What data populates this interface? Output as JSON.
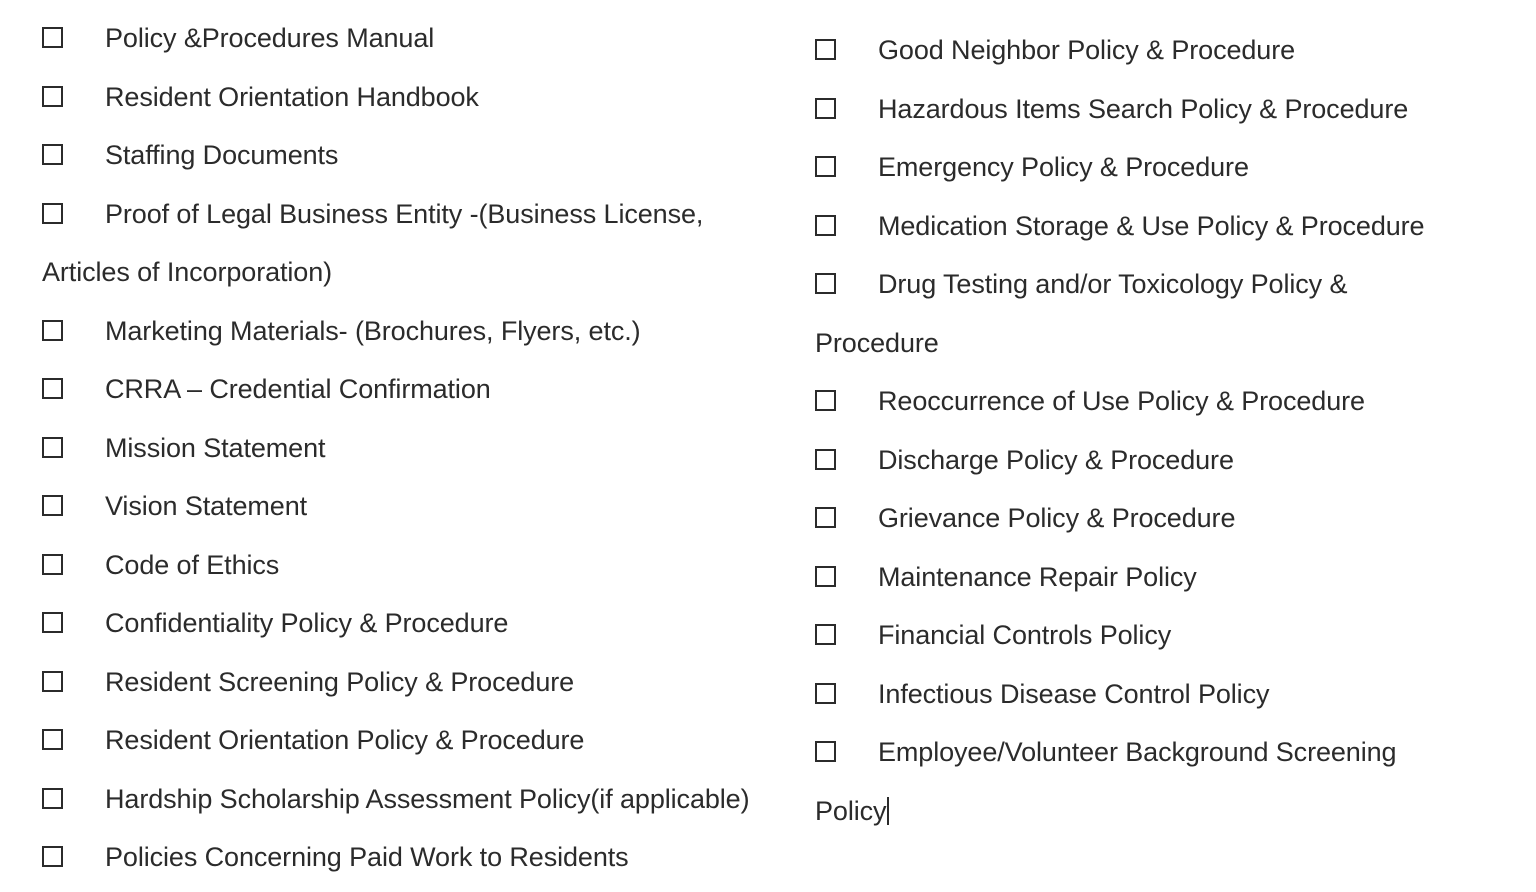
{
  "document": {
    "type": "checklist",
    "background_color": "#ffffff",
    "text_color": "#2b2b2b",
    "checkbox_glyph": "empty-square"
  },
  "left_column": {
    "items": [
      {
        "label": "Policy &Procedures Manual"
      },
      {
        "label": "Resident Orientation Handbook"
      },
      {
        "label": "Staffing Documents"
      },
      {
        "label": "Proof of Legal Business Entity -(Business License,",
        "continuation": "Articles of Incorporation)"
      },
      {
        "label": "Marketing Materials- (Brochures, Flyers, etc.)"
      },
      {
        "label": "CRRA – Credential Confirmation"
      },
      {
        "label": "Mission Statement"
      },
      {
        "label": "Vision Statement"
      },
      {
        "label": "Code of Ethics"
      },
      {
        "label": "Confidentiality Policy & Procedure"
      },
      {
        "label": "Resident Screening Policy & Procedure"
      },
      {
        "label": "Resident Orientation Policy & Procedure"
      },
      {
        "label": "Hardship Scholarship Assessment Policy(if applicable)"
      },
      {
        "label": "Policies Concerning Paid Work to Residents"
      }
    ]
  },
  "right_column": {
    "items": [
      {
        "label": "Good Neighbor Policy & Procedure"
      },
      {
        "label": "Hazardous Items Search Policy & Procedure"
      },
      {
        "label": "Emergency Policy & Procedure"
      },
      {
        "label": "Medication Storage & Use Policy & Procedure"
      },
      {
        "label": "Drug Testing and/or Toxicology Policy &",
        "continuation": "Procedure"
      },
      {
        "label": "Reoccurrence of Use Policy & Procedure"
      },
      {
        "label": "Discharge Policy & Procedure"
      },
      {
        "label": "Grievance Policy & Procedure"
      },
      {
        "label": "Maintenance Repair Policy"
      },
      {
        "label": "Financial Controls Policy"
      },
      {
        "label": "Infectious Disease Control Policy"
      },
      {
        "label": "Employee/Volunteer Background Screening",
        "continuation": "Policy",
        "has_caret": true
      }
    ]
  }
}
